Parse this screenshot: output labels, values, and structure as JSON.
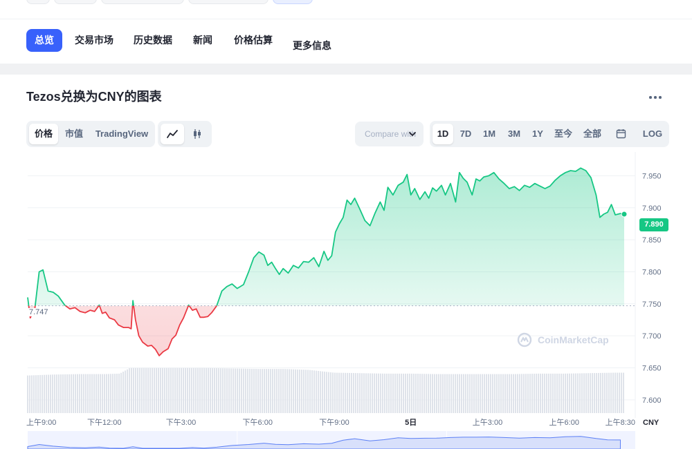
{
  "nav": {
    "items": [
      {
        "label": "总览",
        "active": true
      },
      {
        "label": "交易市场",
        "active": false
      },
      {
        "label": "历史数据",
        "active": false
      },
      {
        "label": "新闻",
        "active": false
      },
      {
        "label": "价格估算",
        "active": false
      },
      {
        "label": "更多信息",
        "active": false
      }
    ]
  },
  "chart_card": {
    "title": "Tezos兑换为CNY的图表",
    "menu_icon": "more-horizontal-icon"
  },
  "view_tabs": [
    {
      "label": "价格",
      "active": true
    },
    {
      "label": "市值",
      "active": false
    },
    {
      "label": "TradingView",
      "active": false
    }
  ],
  "chart_type_toggle": {
    "line_icon": "line-chart-icon",
    "candle_icon": "candlestick-icon",
    "active": "line"
  },
  "compare": {
    "label": "Compare with"
  },
  "range_tabs": [
    {
      "label": "1D",
      "active": true
    },
    {
      "label": "7D",
      "active": false
    },
    {
      "label": "1M",
      "active": false
    },
    {
      "label": "3M",
      "active": false
    },
    {
      "label": "1Y",
      "active": false
    },
    {
      "label": "至今",
      "active": false
    },
    {
      "label": "全部",
      "active": false
    }
  ],
  "calendar_icon": "calendar-icon",
  "log_label": "LOG",
  "watermark": "CoinMarketCap",
  "colors": {
    "up": "#16c784",
    "down": "#ea3943",
    "accent": "#3861fb"
  },
  "chart_data": {
    "type": "area",
    "title": "",
    "currency": "CNY",
    "open_value": "7.747",
    "open_level": 7.747,
    "current_value": "7.890",
    "ylim": [
      7.575,
      7.985
    ],
    "y_ticks": [
      {
        "value": 7.95,
        "label": "7.950"
      },
      {
        "value": 7.9,
        "label": "7.900"
      },
      {
        "value": 7.85,
        "label": "7.850"
      },
      {
        "value": 7.8,
        "label": "7.800"
      },
      {
        "value": 7.75,
        "label": "7.750"
      },
      {
        "value": 7.7,
        "label": "7.700"
      },
      {
        "value": 7.65,
        "label": "7.650"
      },
      {
        "value": 7.6,
        "label": "7.600"
      }
    ],
    "x_ticks": [
      {
        "hour": 0,
        "label": "上午9:00"
      },
      {
        "hour": 3,
        "label": "下午12:00"
      },
      {
        "hour": 6,
        "label": "下午3:00"
      },
      {
        "hour": 9,
        "label": "下午6:00"
      },
      {
        "hour": 12,
        "label": "下午9:00"
      },
      {
        "hour": 15,
        "label": "5日"
      },
      {
        "hour": 18,
        "label": "上午3:00"
      },
      {
        "hour": 21,
        "label": "上午6:00"
      },
      {
        "hour": 23.5,
        "label": "上午8:30"
      }
    ],
    "series": [
      {
        "points": [
          [
            0.0,
            7.76
          ],
          [
            0.1,
            7.728
          ],
          [
            0.28,
            7.742
          ],
          [
            0.45,
            7.8
          ],
          [
            0.6,
            7.803
          ],
          [
            0.8,
            7.77
          ],
          [
            1.0,
            7.768
          ],
          [
            1.2,
            7.762
          ],
          [
            1.45,
            7.748
          ],
          [
            1.65,
            7.742
          ],
          [
            1.85,
            7.744
          ],
          [
            2.05,
            7.738
          ],
          [
            2.25,
            7.736
          ],
          [
            2.45,
            7.74
          ],
          [
            2.62,
            7.738
          ],
          [
            2.8,
            7.748
          ],
          [
            2.92,
            7.735
          ],
          [
            3.05,
            7.737
          ],
          [
            3.2,
            7.728
          ],
          [
            3.4,
            7.725
          ],
          [
            3.55,
            7.717
          ],
          [
            3.75,
            7.713
          ],
          [
            3.95,
            7.713
          ],
          [
            4.05,
            7.711
          ],
          [
            4.12,
            7.755
          ],
          [
            4.22,
            7.725
          ],
          [
            4.35,
            7.7
          ],
          [
            4.5,
            7.69
          ],
          [
            4.7,
            7.684
          ],
          [
            4.85,
            7.685
          ],
          [
            5.0,
            7.679
          ],
          [
            5.15,
            7.669
          ],
          [
            5.3,
            7.675
          ],
          [
            5.5,
            7.68
          ],
          [
            5.65,
            7.695
          ],
          [
            5.8,
            7.701
          ],
          [
            5.95,
            7.717
          ],
          [
            6.1,
            7.728
          ],
          [
            6.3,
            7.748
          ],
          [
            6.45,
            7.74
          ],
          [
            6.6,
            7.742
          ],
          [
            6.75,
            7.729
          ],
          [
            6.9,
            7.729
          ],
          [
            7.05,
            7.73
          ],
          [
            7.2,
            7.736
          ],
          [
            7.4,
            7.747
          ],
          [
            7.6,
            7.77
          ],
          [
            7.8,
            7.777
          ],
          [
            8.0,
            7.781
          ],
          [
            8.2,
            7.774
          ],
          [
            8.45,
            7.78
          ],
          [
            8.65,
            7.8
          ],
          [
            8.85,
            7.822
          ],
          [
            9.05,
            7.831
          ],
          [
            9.25,
            7.826
          ],
          [
            9.4,
            7.81
          ],
          [
            9.55,
            7.815
          ],
          [
            9.7,
            7.805
          ],
          [
            9.85,
            7.796
          ],
          [
            10.0,
            7.805
          ],
          [
            10.2,
            7.798
          ],
          [
            10.4,
            7.81
          ],
          [
            10.6,
            7.806
          ],
          [
            10.8,
            7.816
          ],
          [
            11.0,
            7.815
          ],
          [
            11.2,
            7.822
          ],
          [
            11.4,
            7.808
          ],
          [
            11.6,
            7.832
          ],
          [
            11.75,
            7.818
          ],
          [
            11.9,
            7.825
          ],
          [
            12.05,
            7.862
          ],
          [
            12.2,
            7.875
          ],
          [
            12.35,
            7.885
          ],
          [
            12.5,
            7.912
          ],
          [
            12.65,
            7.905
          ],
          [
            12.8,
            7.915
          ],
          [
            13.0,
            7.898
          ],
          [
            13.2,
            7.88
          ],
          [
            13.4,
            7.872
          ],
          [
            13.6,
            7.892
          ],
          [
            13.8,
            7.909
          ],
          [
            13.95,
            7.896
          ],
          [
            14.1,
            7.932
          ],
          [
            14.3,
            7.92
          ],
          [
            14.5,
            7.935
          ],
          [
            14.7,
            7.94
          ],
          [
            14.85,
            7.952
          ],
          [
            15.0,
            7.92
          ],
          [
            15.15,
            7.93
          ],
          [
            15.35,
            7.913
          ],
          [
            15.55,
            7.925
          ],
          [
            15.7,
            7.915
          ],
          [
            15.85,
            7.931
          ],
          [
            16.0,
            7.926
          ],
          [
            16.2,
            7.935
          ],
          [
            16.35,
            7.92
          ],
          [
            16.55,
            7.938
          ],
          [
            16.75,
            7.909
          ],
          [
            16.9,
            7.955
          ],
          [
            17.05,
            7.946
          ],
          [
            17.2,
            7.94
          ],
          [
            17.4,
            7.92
          ],
          [
            17.55,
            7.945
          ],
          [
            17.7,
            7.942
          ],
          [
            17.85,
            7.948
          ],
          [
            18.05,
            7.95
          ],
          [
            18.25,
            7.955
          ],
          [
            18.45,
            7.945
          ],
          [
            18.65,
            7.938
          ],
          [
            18.85,
            7.93
          ],
          [
            19.05,
            7.933
          ],
          [
            19.25,
            7.927
          ],
          [
            19.45,
            7.935
          ],
          [
            19.65,
            7.932
          ],
          [
            19.85,
            7.938
          ],
          [
            20.05,
            7.934
          ],
          [
            20.25,
            7.93
          ],
          [
            20.45,
            7.934
          ],
          [
            20.65,
            7.943
          ],
          [
            20.85,
            7.95
          ],
          [
            21.05,
            7.955
          ],
          [
            21.25,
            7.958
          ],
          [
            21.45,
            7.957
          ],
          [
            21.65,
            7.962
          ],
          [
            21.85,
            7.958
          ],
          [
            22.05,
            7.947
          ],
          [
            22.25,
            7.92
          ],
          [
            22.4,
            7.885
          ],
          [
            22.55,
            7.89
          ],
          [
            22.7,
            7.893
          ],
          [
            22.85,
            7.905
          ],
          [
            23.0,
            7.889
          ],
          [
            23.2,
            7.891
          ],
          [
            23.35,
            7.89
          ]
        ]
      }
    ],
    "volume": {
      "hours": [
        0,
        1,
        2,
        3,
        3.6,
        4,
        5,
        6,
        7,
        8,
        9,
        10,
        11,
        12,
        13,
        14,
        15,
        16,
        17,
        18,
        19,
        20,
        21,
        22,
        23,
        23.3
      ],
      "levels": [
        0.8,
        0.82,
        0.83,
        0.83,
        0.84,
        0.96,
        0.96,
        0.96,
        0.96,
        0.95,
        0.94,
        0.94,
        0.92,
        0.86,
        0.85,
        0.84,
        0.84,
        0.83,
        0.83,
        0.83,
        0.83,
        0.84,
        0.84,
        0.85,
        0.86,
        0.86
      ]
    }
  }
}
